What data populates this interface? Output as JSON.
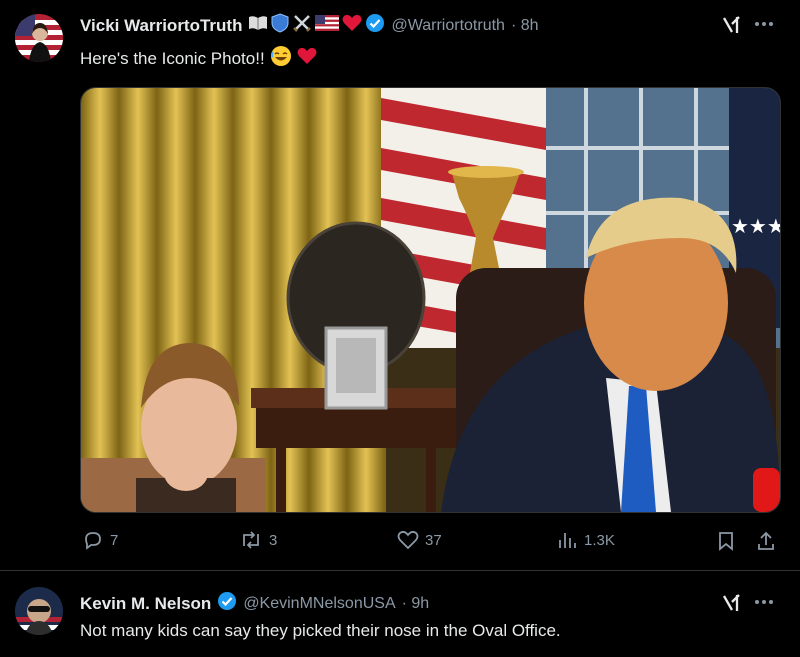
{
  "post1": {
    "display_name": "Vicki WarriortoTruth",
    "handle": "@Warriortotruth",
    "time": "· 8h",
    "text": "Here's the Iconic Photo!!",
    "badges": [
      "book-icon",
      "shield-icon",
      "crossed-swords-icon",
      "us-flag-icon",
      "heart-icon",
      "verified-icon"
    ],
    "text_emoji": [
      "rofl-emoji-icon",
      "heart-icon"
    ],
    "actions": {
      "replies": "7",
      "reposts": "3",
      "likes": "37",
      "views": "1.3K"
    }
  },
  "post2": {
    "display_name": "Kevin M. Nelson",
    "handle": "@KevinMNelsonUSA",
    "time": "· 9h",
    "text": "Not many kids can say they picked their nose in the Oval Office."
  },
  "colors": {
    "background": "#000000",
    "text": "#e7e9ea",
    "muted": "#8b98a5",
    "verified": "#1d9bf0",
    "heart": "#f91880",
    "divider": "#2f3336"
  }
}
